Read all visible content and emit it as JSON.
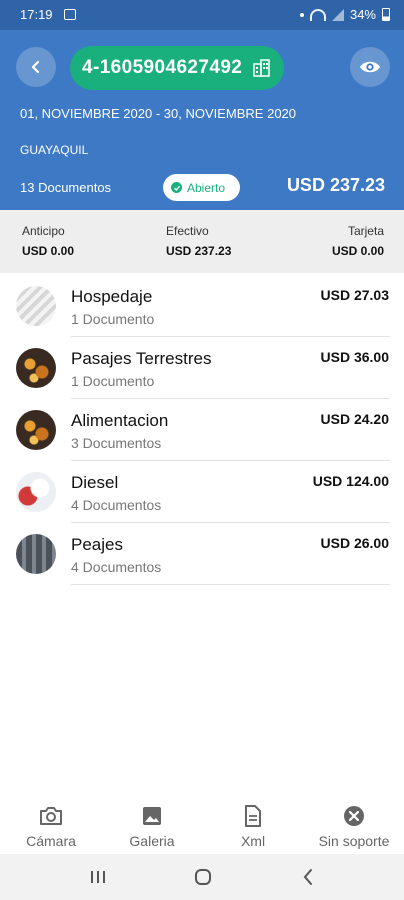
{
  "status_bar": {
    "time": "17:19",
    "battery": "34%"
  },
  "header": {
    "code": "4-1605904627492",
    "period": "01, NOVIEMBRE 2020 - 30, NOVIEMBRE 2020",
    "city": "GUAYAQUIL",
    "documents": "13 Documentos",
    "status": "Abierto",
    "total": "USD 237.23",
    "colors": {
      "header_bg": "#3d79c5",
      "statusbar_bg": "#2f65a8",
      "pill": "#19b07e"
    }
  },
  "summary": [
    {
      "label": "Anticipo",
      "value": "USD 0.00"
    },
    {
      "label": "Efectivo",
      "value": "USD 237.23"
    },
    {
      "label": "Tarjeta",
      "value": "USD 0.00"
    }
  ],
  "categories": [
    {
      "name": "Hospedaje",
      "count": "1 Documento",
      "amount": "USD 27.03"
    },
    {
      "name": "Pasajes Terrestres",
      "count": "1 Documento",
      "amount": "USD 36.00"
    },
    {
      "name": "Alimentacion",
      "count": "3 Documentos",
      "amount": "USD 24.20"
    },
    {
      "name": "Diesel",
      "count": "4 Documentos",
      "amount": "USD 124.00"
    },
    {
      "name": "Peajes",
      "count": "4 Documentos",
      "amount": "USD 26.00"
    }
  ],
  "bottom_tabs": [
    {
      "label": "Cámara",
      "icon": "camera-icon"
    },
    {
      "label": "Galeria",
      "icon": "image-icon"
    },
    {
      "label": "Xml",
      "icon": "file-icon"
    },
    {
      "label": "Sin soporte",
      "icon": "close-circle-icon"
    }
  ]
}
